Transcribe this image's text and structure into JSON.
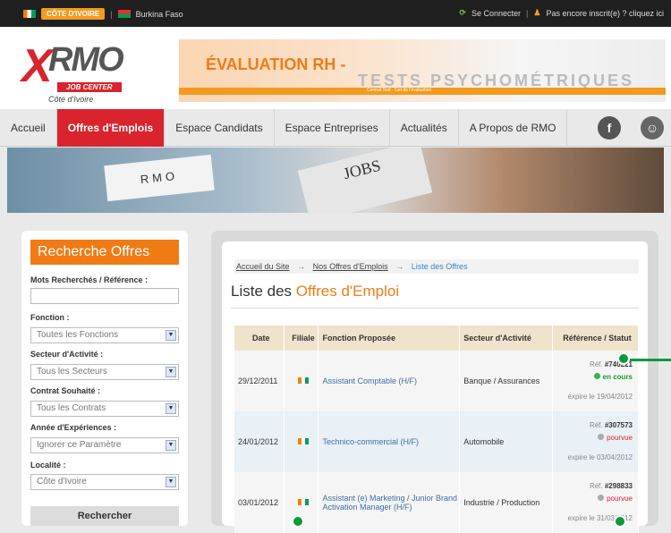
{
  "topbar": {
    "country_active": "CÔTE D'IVOIRE",
    "country_other": "Burkina Faso",
    "login": "Se Connecter",
    "register": "Pas encore inscrit(e) ? cliquez ici"
  },
  "header": {
    "logo_brand": "RMO",
    "logo_tagline": "JOB CENTER",
    "logo_country": "Côte d'Ivoire",
    "banner_title": "ÉVALUATION RH -",
    "banner_subtitle": "TESTS PSYCHOMÉTRIQUES",
    "banner_strip": "Central Test - l'art de l'évaluation"
  },
  "nav": {
    "items": [
      {
        "label": "Accueil"
      },
      {
        "label": "Offres d'Emplois"
      },
      {
        "label": "Espace Candidats"
      },
      {
        "label": "Espace Entreprises"
      },
      {
        "label": "Actualités"
      },
      {
        "label": "A Propos de RMO"
      }
    ]
  },
  "hero": {
    "card_text": "RMO",
    "paper_text": "JOBS"
  },
  "sidebar": {
    "title": "Recherche Offres",
    "keyword_label": "Mots Recherchés / Référence :",
    "keyword_value": "",
    "function_label": "Fonction :",
    "function_value": "Toutes les Fonctions",
    "sector_label": "Secteur d'Activité :",
    "sector_value": "Tous les Secteurs",
    "contract_label": "Contrat Souhaité :",
    "contract_value": "Tous les Contrats",
    "experience_label": "Année d'Expériences :",
    "experience_value": "Ignorer ce Paramètre",
    "location_label": "Localité :",
    "location_value": "Côte d'Ivoire",
    "search_button": "Rechercher"
  },
  "main": {
    "breadcrumb": {
      "home": "Accueil du Site",
      "offers": "Nos Offres d'Emplois",
      "current": "Liste des Offres"
    },
    "title_prefix": "Liste des",
    "title_highlight": "Offres d'Emploi",
    "table": {
      "headers": [
        "Date",
        "Filiale",
        "Fonction Proposée",
        "Secteur d'Activité",
        "Référence / Statut"
      ],
      "rows": [
        {
          "date": "29/12/2011",
          "function": "Assistant Comptable (H/F)",
          "sector": "Banque / Assurances",
          "ref_label": "Réf.",
          "ref": "#740221",
          "status": "en cours",
          "expiry": "expire le 19/04/2012"
        },
        {
          "date": "24/01/2012",
          "function": "Technico-commercial (H/F)",
          "sector": "Automobile",
          "ref_label": "Réf.",
          "ref": "#307573",
          "status": "pourvue",
          "expiry": "expire le 03/04/2012"
        },
        {
          "date": "03/01/2012",
          "function": "Assistant (e) Marketing / Junior Brand Activation Manager (H/F)",
          "sector": "Industrie / Production",
          "ref_label": "Réf.",
          "ref": "#298833",
          "status": "pourvue",
          "expiry": "expire le 31/03/2012"
        }
      ]
    }
  },
  "colors": {
    "accent_orange": "#f07b15",
    "brand_red": "#d9242d",
    "status_open": "#1d9a2b",
    "status_filled": "#d9242d"
  }
}
